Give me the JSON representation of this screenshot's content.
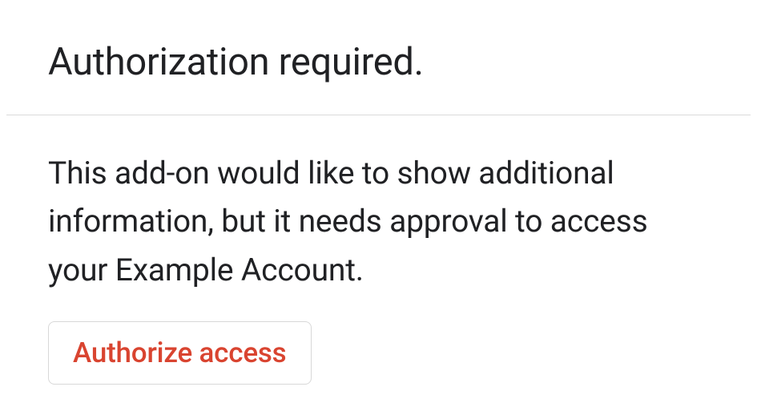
{
  "dialog": {
    "title": "Authorization required.",
    "description": "This add-on would like to show additional information, but it needs approval to access your Example Account.",
    "authorize_button_label": "Authorize access"
  }
}
